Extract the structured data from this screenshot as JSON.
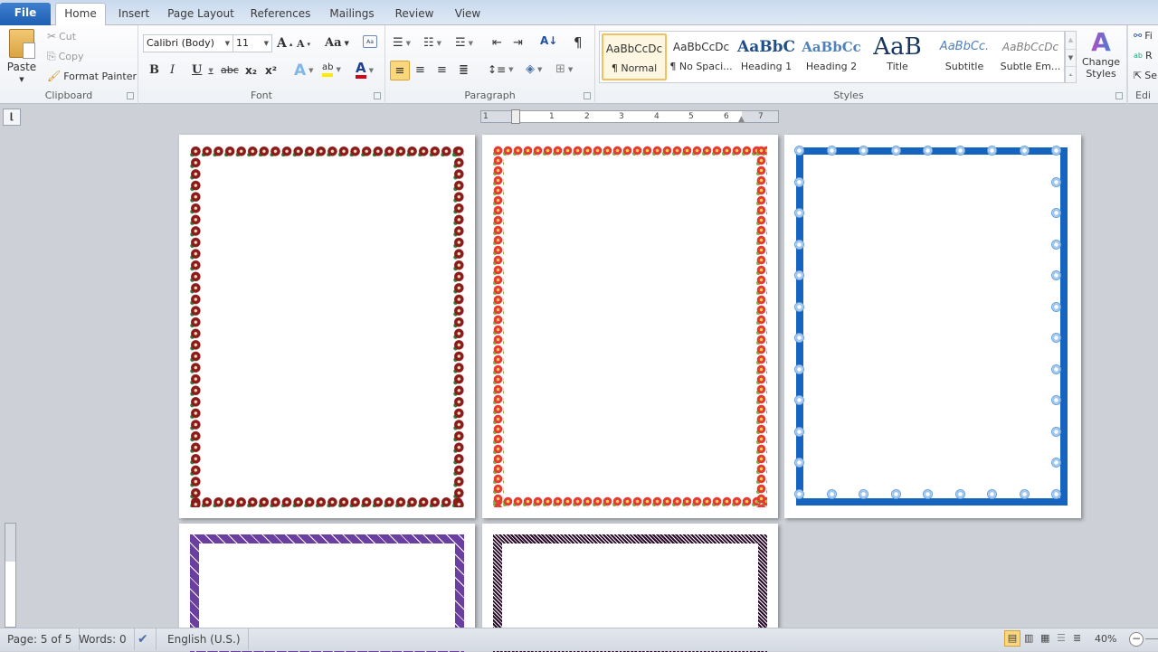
{
  "tabs": [
    {
      "label": "File"
    },
    {
      "label": "Home"
    },
    {
      "label": "Insert"
    },
    {
      "label": "Page Layout"
    },
    {
      "label": "References"
    },
    {
      "label": "Mailings"
    },
    {
      "label": "Review"
    },
    {
      "label": "View"
    }
  ],
  "active_tab": "Home",
  "clipboard": {
    "paste": "Paste",
    "cut": "Cut",
    "copy": "Copy",
    "format_painter": "Format Painter",
    "label": "Clipboard"
  },
  "font": {
    "name": "Calibri (Body)",
    "size": "11",
    "label": "Font",
    "grow": "A",
    "shrink": "A",
    "change_case": "Aa",
    "bold": "B",
    "italic": "I",
    "underline": "U",
    "strike": "abc",
    "subscript": "x₂",
    "superscript": "x²",
    "text_effects": "A",
    "highlight": "ab",
    "font_color": "A",
    "font_color_hex": "#d0021b",
    "highlight_hex": "#ffeb00"
  },
  "paragraph": {
    "label": "Paragraph",
    "pilcrow": "¶"
  },
  "styles": {
    "label": "Styles",
    "items": [
      {
        "sample": "AaBbCcDc",
        "name": "¶ Normal",
        "selected": true
      },
      {
        "sample": "AaBbCcDc",
        "name": "¶ No Spaci..."
      },
      {
        "sample": "AaBbC",
        "name": "Heading 1"
      },
      {
        "sample": "AaBbCc",
        "name": "Heading 2"
      },
      {
        "sample": "AaB",
        "name": "Title"
      },
      {
        "sample": "AaBbCc.",
        "name": "Subtitle"
      },
      {
        "sample": "AaBbCcDc",
        "name": "Subtle Em..."
      }
    ],
    "change_styles": "Change Styles"
  },
  "editing": {
    "find": "Fi",
    "replace": "R",
    "select": "Se",
    "label": "Edi"
  },
  "ruler": {
    "numbers": [
      "1",
      "1",
      "2",
      "3",
      "4",
      "5",
      "6",
      "7"
    ]
  },
  "pages": [
    {
      "border": "red-roses",
      "color": "#8b1a1a",
      "accent": "#2e7d32"
    },
    {
      "border": "red-poinsettia",
      "color": "#e53935",
      "accent": "#7cb342"
    },
    {
      "border": "blue-flowers",
      "color": "#1565c0",
      "accent": "#e3f2fd"
    },
    {
      "border": "purple-vine",
      "color": "#6a3fa0",
      "accent": "#ffffff"
    },
    {
      "border": "black-crosshatch",
      "color": "#2a0a2a",
      "accent": "#ffffff"
    }
  ],
  "status": {
    "page": "Page: 5 of 5",
    "words": "Words: 0",
    "language": "English (U.S.)",
    "zoom": "40%"
  }
}
